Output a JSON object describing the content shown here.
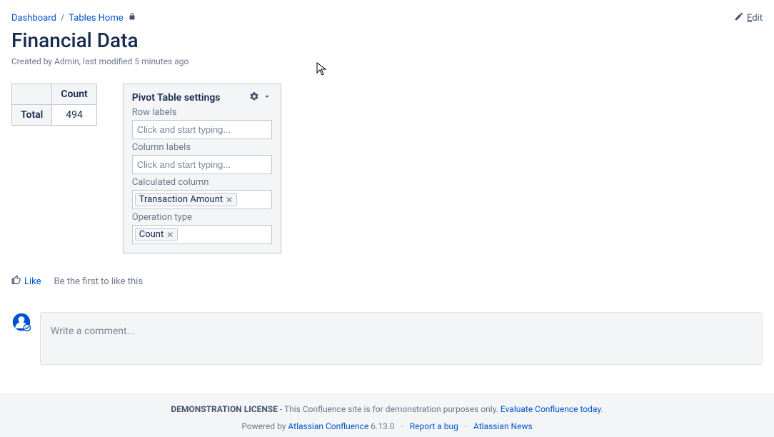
{
  "breadcrumbs": {
    "dashboard": "Dashboard",
    "tables_home": "Tables Home"
  },
  "edit_label": "Edit",
  "page_title": "Financial Data",
  "byline": "Created by Admin, last modified 5 minutes ago",
  "pivot_result": {
    "header_count": "Count",
    "row_total": "Total",
    "value": "494"
  },
  "pivot_settings": {
    "title": "Pivot Table settings",
    "row_labels_label": "Row labels",
    "row_labels_placeholder": "Click and start typing...",
    "column_labels_label": "Column labels",
    "column_labels_placeholder": "Click and start typing...",
    "calculated_column_label": "Calculated column",
    "calculated_column_tag": "Transaction Amount",
    "operation_type_label": "Operation type",
    "operation_type_tag": "Count"
  },
  "like": {
    "label": "Like",
    "hint": "Be the first to like this"
  },
  "comment_placeholder": "Write a comment...",
  "footer": {
    "demo_bold": "DEMONSTRATION LICENSE",
    "demo_rest": " - This Confluence site is for demonstration purposes only. ",
    "evaluate": "Evaluate Confluence today",
    "powered": "Powered by ",
    "atlassian": "Atlassian Confluence",
    "version": " 6.13.0",
    "report_bug": "Report a bug",
    "news": "Atlassian News"
  }
}
